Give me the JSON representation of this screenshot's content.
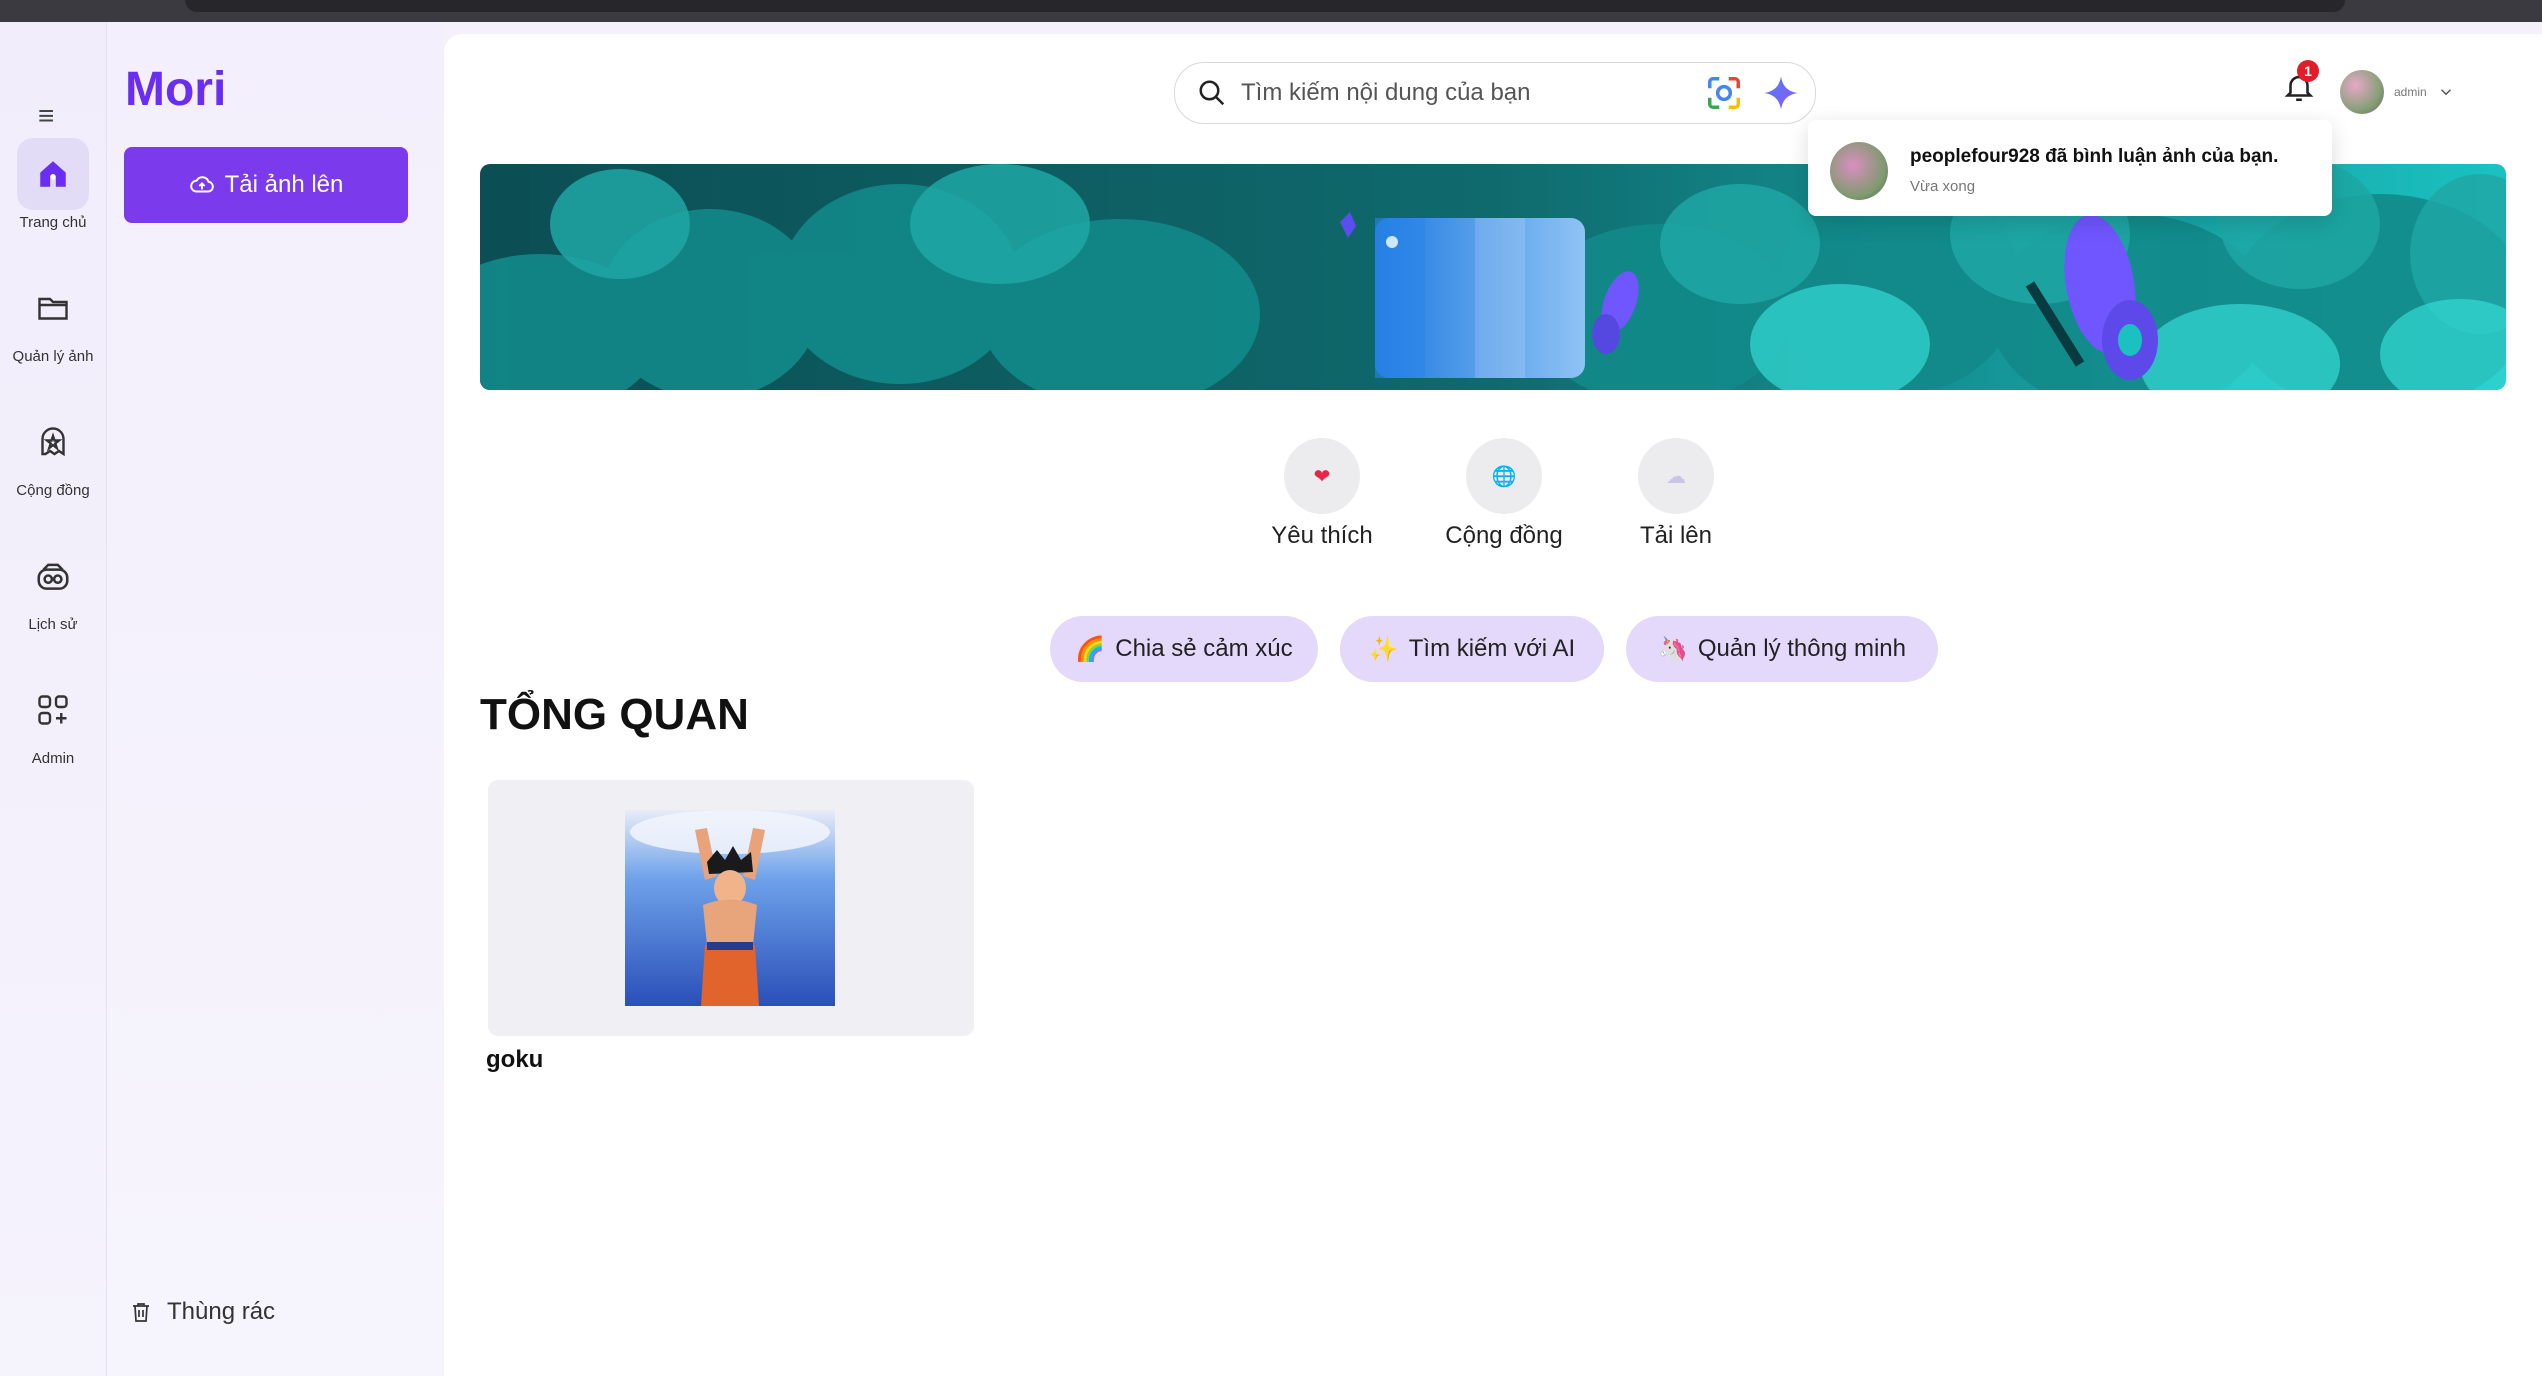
{
  "app": {
    "logo": "Mori"
  },
  "rail": {
    "items": [
      {
        "label": "Trang chủ",
        "icon": "home-icon"
      },
      {
        "label": "Quản lý ảnh",
        "icon": "folder-icon"
      },
      {
        "label": "Cộng đồng",
        "icon": "community-icon"
      },
      {
        "label": "Lịch sử",
        "icon": "history-icon"
      },
      {
        "label": "Admin",
        "icon": "admin-grid-icon"
      }
    ]
  },
  "side": {
    "upload_label": "Tải ảnh lên",
    "trash_label": "Thùng rác"
  },
  "header": {
    "search_placeholder": "Tìm kiếm nội dung của bạn",
    "notification_count": "1",
    "user_name": "admin"
  },
  "notification": {
    "message": "peoplefour928 đã bình luận ảnh của bạn.",
    "time": "Vừa xong"
  },
  "quick_actions": [
    {
      "label": "Yêu thích",
      "icon": "heart-icon",
      "glyph": "❤"
    },
    {
      "label": "Cộng đồng",
      "icon": "globe-icon",
      "glyph": "🌐"
    },
    {
      "label": "Tải lên",
      "icon": "cloud-icon",
      "glyph": "☁"
    }
  ],
  "chips": [
    {
      "label": "Chia sẻ cảm xúc",
      "emoji": "🌈"
    },
    {
      "label": "Tìm kiếm với AI",
      "emoji": "✨"
    },
    {
      "label": "Quản lý thông minh",
      "emoji": "🦄"
    }
  ],
  "overview": {
    "title": "TỔNG QUAN",
    "items": [
      {
        "name": "goku"
      }
    ]
  },
  "colors": {
    "accent": "#7c3aed",
    "logo": "#6a2df2",
    "chip": "#e4d8fb",
    "badge": "#e11d2a"
  }
}
